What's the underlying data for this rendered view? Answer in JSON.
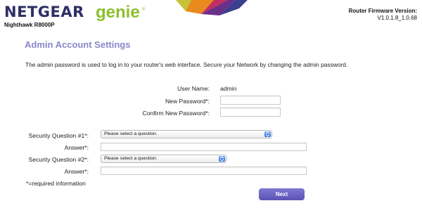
{
  "header": {
    "brand": "NETGEAR",
    "product": "genie",
    "trademark": "®",
    "model": "Nighthawk R8000P",
    "firmware_label": "Router Firmware Version:",
    "firmware_value": "V1.0.1.8_1.0.68",
    "banner_colors": [
      "#c8c13a",
      "#e88a1e",
      "#c22e5e",
      "#6a2f8a",
      "#3b3f8e"
    ]
  },
  "page": {
    "title": "Admin Account Settings",
    "description": "The admin password is used to log in to your router's web interface. Secure your Network by changing the admin password."
  },
  "account": {
    "username_label": "User Name:",
    "username_value": "admin",
    "new_password_label": "New Password*:",
    "new_password_value": "",
    "confirm_password_label": "Confirm New Password*:",
    "confirm_password_value": ""
  },
  "security": {
    "q1_label": "Security Question #1*:",
    "q1_selected": "Please select a question.",
    "a1_label": "Answer*:",
    "a1_value": "",
    "q2_label": "Security Question #2*:",
    "q2_selected": "Please select a question.",
    "a2_label": "Answer*:",
    "a2_value": ""
  },
  "footer": {
    "required_note": "*=required information",
    "next_label": "Next"
  },
  "colors": {
    "accent": "#8a87c8",
    "button": "#625ab9",
    "genie_green": "#8cbf2f",
    "brand_navy": "#2f2f66"
  }
}
